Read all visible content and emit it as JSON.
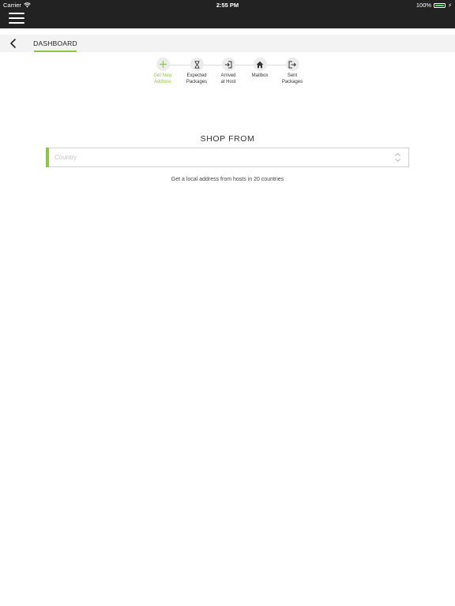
{
  "status_bar": {
    "carrier": "Carrier",
    "time": "2:55 PM",
    "battery": "100%",
    "battery_color": "#4cd964"
  },
  "nav": {
    "menu_icon": "hamburger-menu-icon",
    "back_icon": "chevron-left-icon",
    "tab_label": "DASHBOARD",
    "tab_active_color": "#8dc63f"
  },
  "stepper": {
    "active_color": "#8dc63f",
    "steps": [
      {
        "icon": "plus-icon",
        "line1": "Get New",
        "line2": "Address"
      },
      {
        "icon": "hourglass-icon",
        "line1": "Expected",
        "line2": "Packages"
      },
      {
        "icon": "sign-in-icon",
        "line1": "Arrived",
        "line2": "at Host"
      },
      {
        "icon": "home-icon",
        "line1": "Mailbox",
        "line2": ""
      },
      {
        "icon": "sign-out-icon",
        "line1": "Sent",
        "line2": "Packages"
      }
    ]
  },
  "main": {
    "title": "SHOP FROM",
    "country_placeholder": "Country",
    "accent_color": "#8dc63f",
    "helper": "Get a local address from hosts in 20 countries"
  }
}
